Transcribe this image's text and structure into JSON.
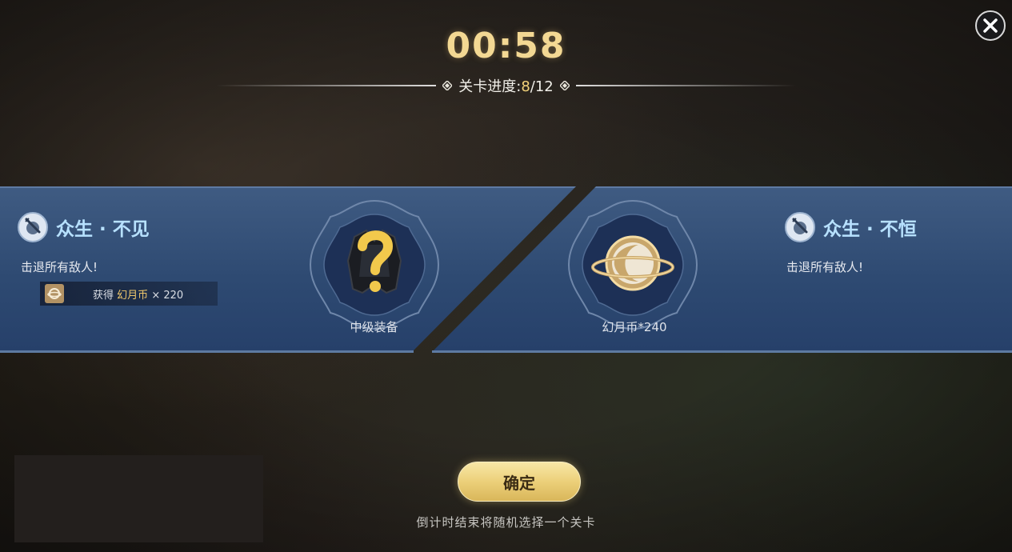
{
  "timer": "00:58",
  "progress": {
    "label": "关卡进度:",
    "current": "8",
    "total": "/12"
  },
  "stages": [
    {
      "title": "众生 · 不见",
      "desc": "击退所有敌人!",
      "reward_bar": {
        "prefix": "获得",
        "currency": "幻月币",
        "amount": "× 220"
      },
      "emblem_label": "中级装备",
      "icon": "sword-shield-icon"
    },
    {
      "title": "众生 · 不恒",
      "desc": "击退所有敌人!",
      "emblem_label": "幻月币*240",
      "icon": "sword-shield-icon"
    }
  ],
  "confirm_label": "确定",
  "hint": "倒计时结束将随机选择一个关卡",
  "colors": {
    "timer": "#f3d893",
    "progress_current": "#f3d27a",
    "title_blue": "#b7e1ff",
    "panel_blue": "#2e4a72",
    "button_gold": "#ecd07a"
  }
}
